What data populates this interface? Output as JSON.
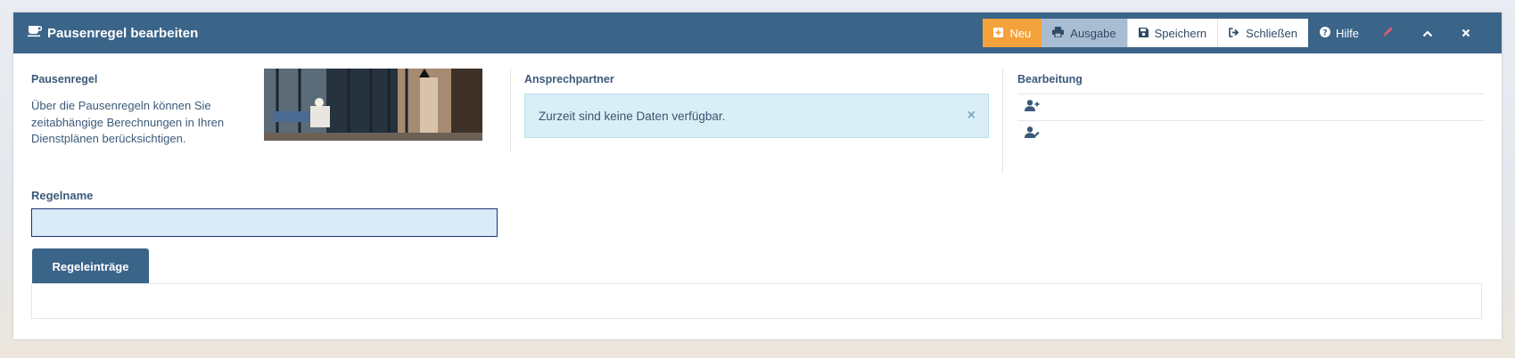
{
  "window": {
    "title": "Pausenregel bearbeiten"
  },
  "toolbar": {
    "new_label": "Neu",
    "output_label": "Ausgabe",
    "save_label": "Speichern",
    "close_label": "Schließen",
    "help_label": "Hilfe"
  },
  "info": {
    "heading": "Pausenregel",
    "description": "Über die Pausenregeln können Sie zeitabhängige Berechnungen in Ihren Dienstplänen berücksichtigen."
  },
  "contacts": {
    "heading": "Ansprechpartner",
    "empty_message": "Zurzeit sind keine Daten verfügbar."
  },
  "editing": {
    "heading": "Bearbeitung",
    "items": [
      {
        "icon": "user-plus-icon"
      },
      {
        "icon": "user-edit-icon"
      }
    ]
  },
  "form": {
    "rule_name_label": "Regelname",
    "rule_name_value": ""
  },
  "tabs": [
    {
      "label": "Regeleinträge",
      "active": true
    }
  ],
  "colors": {
    "header": "#3b6489",
    "new_button": "#f4a23b",
    "output_button": "#a9bdd2",
    "alert_bg": "#d9eef6",
    "input_bg": "#d9ebf7",
    "edit_icon": "#e05b6f"
  }
}
